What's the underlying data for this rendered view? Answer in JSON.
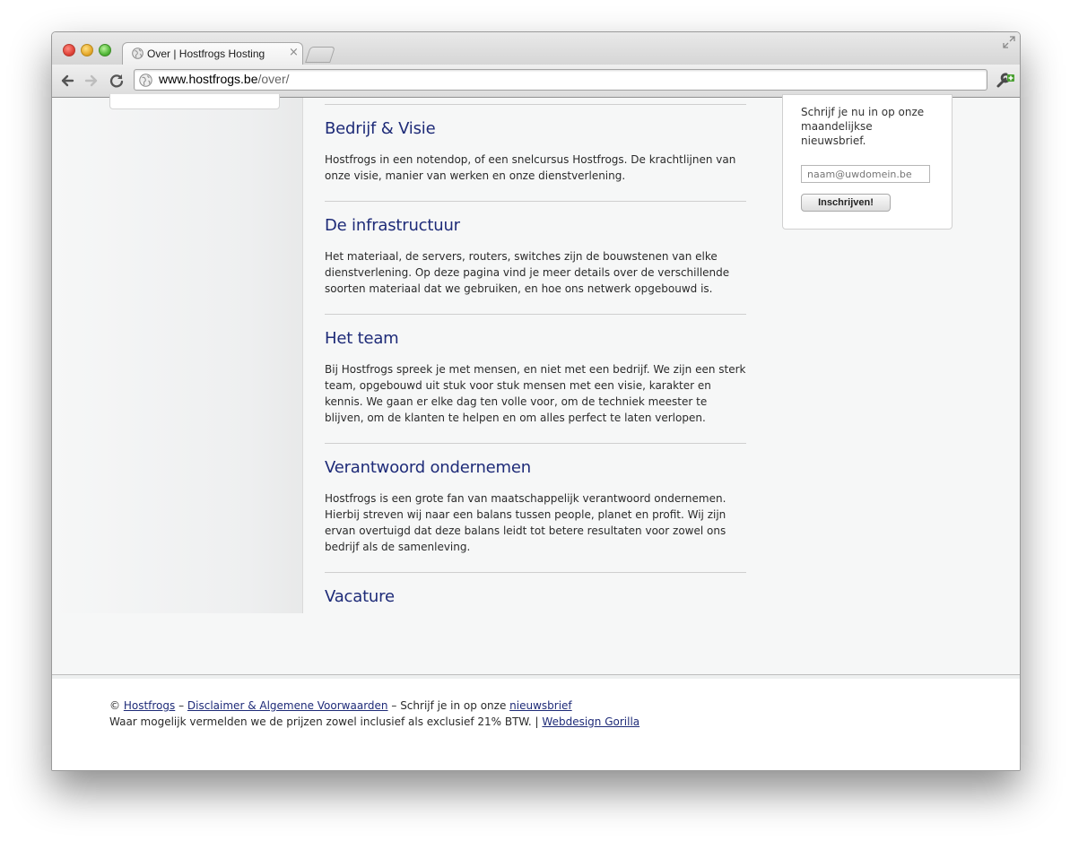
{
  "browser": {
    "tab_title": "Over | Hostfrogs Hosting",
    "tab_close": "×",
    "url_host": "www.hostfrogs.be",
    "url_path": "/over/"
  },
  "sections": [
    {
      "heading": "Bedrijf & Visie",
      "text": "Hostfrogs in een notendop, of een snelcursus Hostfrogs. De krachtlijnen van onze visie, manier van werken en onze dienstverlening."
    },
    {
      "heading": "De infrastructuur",
      "text": "Het materiaal, de servers, routers, switches zijn de bouwstenen van elke dienstverlening. Op deze pagina vind je meer details over de verschillende soorten materiaal dat we gebruiken, en hoe ons netwerk opgebouwd is."
    },
    {
      "heading": "Het team",
      "text": "Bij Hostfrogs spreek je met mensen, en niet met een bedrijf. We zijn een sterk team, opgebouwd uit stuk voor stuk mensen met een visie, karakter en kennis. We gaan er elke dag ten volle voor, om de techniek meester te blijven, om de klanten te helpen en om alles perfect te laten verlopen."
    },
    {
      "heading": "Verantwoord ondernemen",
      "text": "Hostfrogs is een grote fan van maatschappelijk verantwoord ondernemen. Hierbij streven wij naar een balans tussen people, planet en profit. Wij zijn ervan overtuigd dat deze balans leidt tot betere resultaten voor zowel ons bedrijf als de samenleving."
    },
    {
      "heading": "Vacature",
      "text": ""
    }
  ],
  "newsletter": {
    "text": "Schrijf je nu in op onze maandelijkse nieuwsbrief.",
    "placeholder": "naam@uwdomein.be",
    "button": "Inschrijven!"
  },
  "footer": {
    "copyright": "©",
    "hostfrogs_link": "Hostfrogs",
    "sep1": "–",
    "disclaimer_link": "Disclaimer & Algemene Voorwaarden",
    "sep2": "–",
    "subscribe_text": "Schrijf je in op onze",
    "newsletter_link": "nieuwsbrief",
    "vat_text": "Waar mogelijk vermelden we de prijzen zowel inclusief als exclusief 21% BTW.",
    "pipe": "|",
    "webdesign_link": "Webdesign Gorilla"
  },
  "colors": {
    "heading": "#1e2b78",
    "link": "#1e2b78",
    "page_bg": "#f6f7f7"
  }
}
